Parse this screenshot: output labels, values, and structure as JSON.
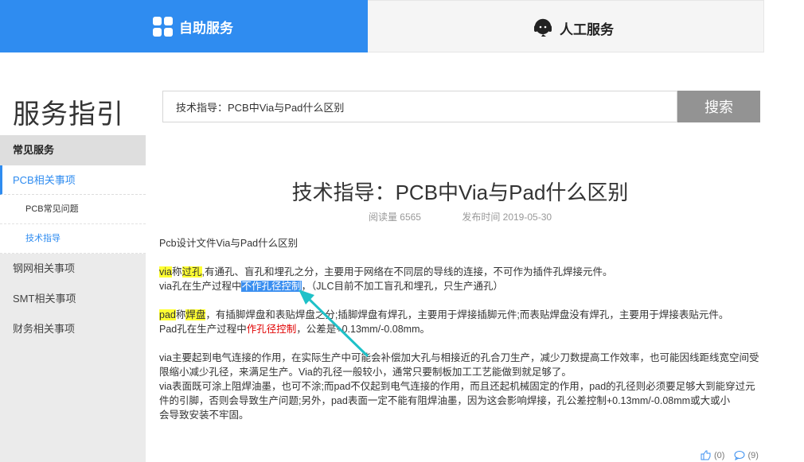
{
  "tabs": {
    "self_service": "自助服务",
    "human_service": "人工服务"
  },
  "sidebar": {
    "title": "服务指引",
    "section_header": "常见服务",
    "items": [
      {
        "label": "PCB相关事项"
      },
      {
        "label": "PCB常见问题"
      },
      {
        "label": "技术指导"
      },
      {
        "label": "钢网相关事项"
      },
      {
        "label": "SMT相关事项"
      },
      {
        "label": "财务相关事项"
      }
    ]
  },
  "search": {
    "value": "技术指导：PCB中Via与Pad什么区别",
    "button": "搜索"
  },
  "article": {
    "title": "技术指导：PCB中Via与Pad什么区别",
    "reads": "阅读量 6565",
    "published": "发布时间 2019-05-30",
    "intro": "Pcb设计文件Via与Pad什么区别",
    "p1": {
      "via": "via",
      "cheng": "称",
      "guokong": "过孔",
      "rest": ",有通孔、盲孔和埋孔之分，主要用于网络在不同层的导线的连接，不可作为插件孔焊接元件。"
    },
    "p2": {
      "prefix": "via孔在生产过程中",
      "highlight": "不作孔径控制",
      "suffix": "，（JLC目前不加工盲孔和埋孔，只生产通孔）"
    },
    "p3": {
      "pad": "pad",
      "cheng": "称",
      "hanpan": "焊盘",
      "rest": "，有插脚焊盘和表贴焊盘之分;插脚焊盘有焊孔，主要用于焊接插脚元件;而表贴焊盘没有焊孔，主要用于焊接表贴元件。"
    },
    "p4": {
      "prefix": "Pad孔在生产过程中",
      "red": "作孔径控制",
      "suffix": "，公差是+0.13mm/-0.08mm。"
    },
    "p5": "via主要起到电气连接的作用，在实际生产中可能会补偿加大孔与相接近的孔合刀生产，减少刀数提高工作效率，也可能因线距线宽空间受限缩小减少孔径，来满足生产。Via的孔径一般较小，通常只要制板加工工艺能做到就足够了。",
    "p6": "via表面既可涂上阻焊油墨，也可不涂;而pad不仅起到电气连接的作用，而且还起机械固定的作用，pad的孔径则必须要足够大到能穿过元件的引脚，否则会导致生产问题;另外，pad表面一定不能有阻焊油墨，因为这会影响焊接，孔公差控制+0.13mm/-0.08mm或大或小",
    "p7": "会导致安装不牢固。"
  },
  "reactions": {
    "likes": "(0)",
    "comments": "(9)"
  },
  "colors": {
    "accent": "#2f8cf0",
    "highlight_yellow": "#ffff33",
    "annotation_arrow": "#1fc1c8"
  }
}
